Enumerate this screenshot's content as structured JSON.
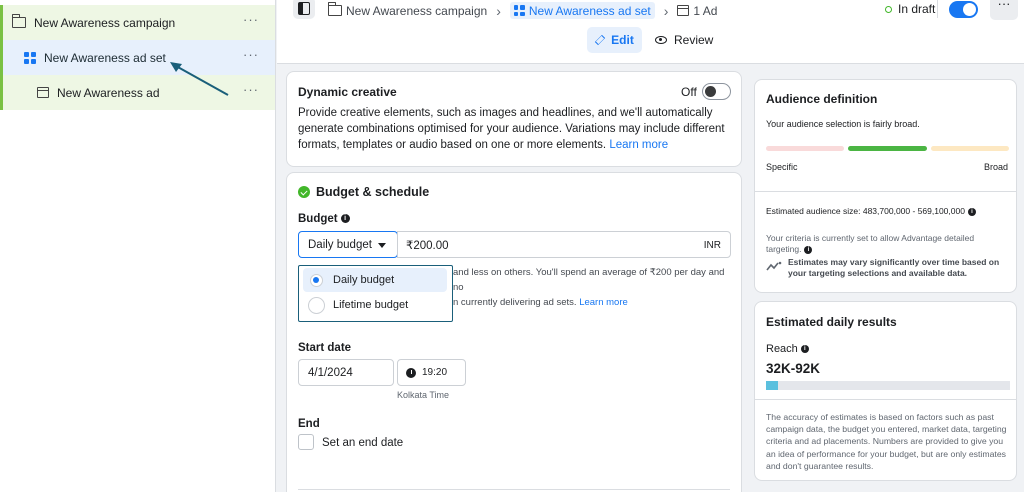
{
  "sidebar": {
    "campaign_label": "New Awareness campaign",
    "adset_label": "New Awareness ad set",
    "ad_label": "New Awareness ad",
    "more_glyph": "···"
  },
  "topbar": {
    "breadcrumbs": [
      "New Awareness campaign",
      "New Awareness ad set",
      "1 Ad"
    ],
    "status": "In draft",
    "more_glyph": "···"
  },
  "modes": {
    "edit": "Edit",
    "review": "Review"
  },
  "dynamic_creative": {
    "title": "Dynamic creative",
    "toggle_state": "Off",
    "body": "Provide creative elements, such as images and headlines, and we'll automatically generate combinations optimised for your audience. Variations may include different formats, templates or audio based on one or more elements.",
    "link": "Learn more"
  },
  "budget_schedule": {
    "title": "Budget & schedule",
    "budget_label": "Budget",
    "budget_type": "Daily budget",
    "amount": "₹200.00",
    "currency": "INR",
    "help_line1": "and less on others. You'll spend an average of ₹200 per day and no",
    "help_line2": "n currently delivering ad sets.",
    "help_link": "Learn more",
    "dropdown_options": [
      "Daily budget",
      "Lifetime budget"
    ],
    "start_date_label": "Start date",
    "start_date": "4/1/2024",
    "start_time": "19:20",
    "timezone": "Kolkata Time",
    "end_label": "End",
    "end_checkbox_label": "Set an end date"
  },
  "audience": {
    "title": "Audience definition",
    "subtitle": "Your audience selection is fairly broad.",
    "specific": "Specific",
    "broad": "Broad",
    "size": "Estimated audience size: 483,700,000 - 569,100,000",
    "criteria": "Your criteria is currently set to allow Advantage detailed targeting.",
    "warning": "Estimates may vary significantly over time based on your targeting selections and available data."
  },
  "estimated": {
    "title": "Estimated daily results",
    "reach_label": "Reach",
    "reach_value": "32K-92K",
    "reach_fill_fraction": 0.05,
    "body": "The accuracy of estimates is based on factors such as past campaign data, the budget you entered, market data, targeting criteria and ad placements. Numbers are provided to give you an idea of performance for your budget, but are only estimates and don't guarantee results."
  },
  "colors": {
    "accent": "#1877f2",
    "tree_green": "#7ac143",
    "annotation_arrow": "#1a5f7a"
  }
}
